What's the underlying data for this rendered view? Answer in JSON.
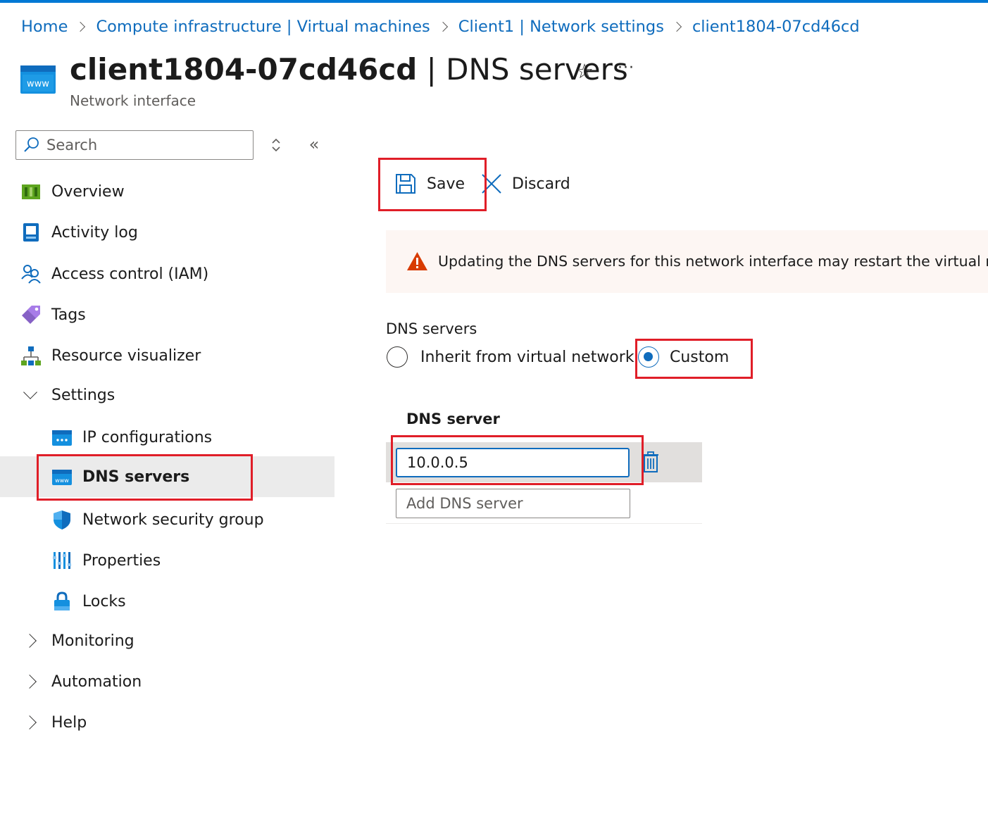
{
  "breadcrumb": [
    "Home",
    "Compute infrastructure | Virtual machines",
    "Client1 | Network settings",
    "client1804-07cd46cd"
  ],
  "header": {
    "resource_name": "client1804-07cd46cd",
    "separator": " | ",
    "blade_name": "DNS servers",
    "subtitle": "Network interface",
    "favorite_icon": "star-icon",
    "more_label": "···"
  },
  "sidebar": {
    "search_placeholder": "Search",
    "collapse_label": "«",
    "items": [
      {
        "label": "Overview",
        "icon": "overview-icon"
      },
      {
        "label": "Activity log",
        "icon": "activity-log-icon"
      },
      {
        "label": "Access control (IAM)",
        "icon": "iam-icon"
      },
      {
        "label": "Tags",
        "icon": "tag-icon"
      },
      {
        "label": "Resource visualizer",
        "icon": "resource-visualizer-icon"
      }
    ],
    "settings": {
      "label": "Settings",
      "expanded": true,
      "items": [
        {
          "label": "IP configurations",
          "icon": "ip-config-icon"
        },
        {
          "label": "DNS servers",
          "icon": "dns-icon",
          "selected": true
        },
        {
          "label": "Network security group",
          "icon": "shield-icon"
        },
        {
          "label": "Properties",
          "icon": "properties-icon"
        },
        {
          "label": "Locks",
          "icon": "lock-icon"
        }
      ]
    },
    "groups": [
      {
        "label": "Monitoring",
        "expanded": false
      },
      {
        "label": "Automation",
        "expanded": false
      },
      {
        "label": "Help",
        "expanded": false
      }
    ]
  },
  "toolbar": {
    "save_label": "Save",
    "discard_label": "Discard"
  },
  "warning": {
    "text": "Updating the DNS servers for this network interface may restart the virtual machin"
  },
  "dns": {
    "section_label": "DNS servers",
    "options": [
      {
        "label": "Inherit from virtual network",
        "checked": false
      },
      {
        "label": "Custom",
        "checked": true
      }
    ],
    "column_header": "DNS server",
    "servers": [
      "10.0.0.5"
    ],
    "add_placeholder": "Add DNS server"
  },
  "colors": {
    "accent": "#0f6cbd",
    "highlight": "#e01e28",
    "warning": "#d83b01",
    "selected_row": "#ebebeb"
  }
}
